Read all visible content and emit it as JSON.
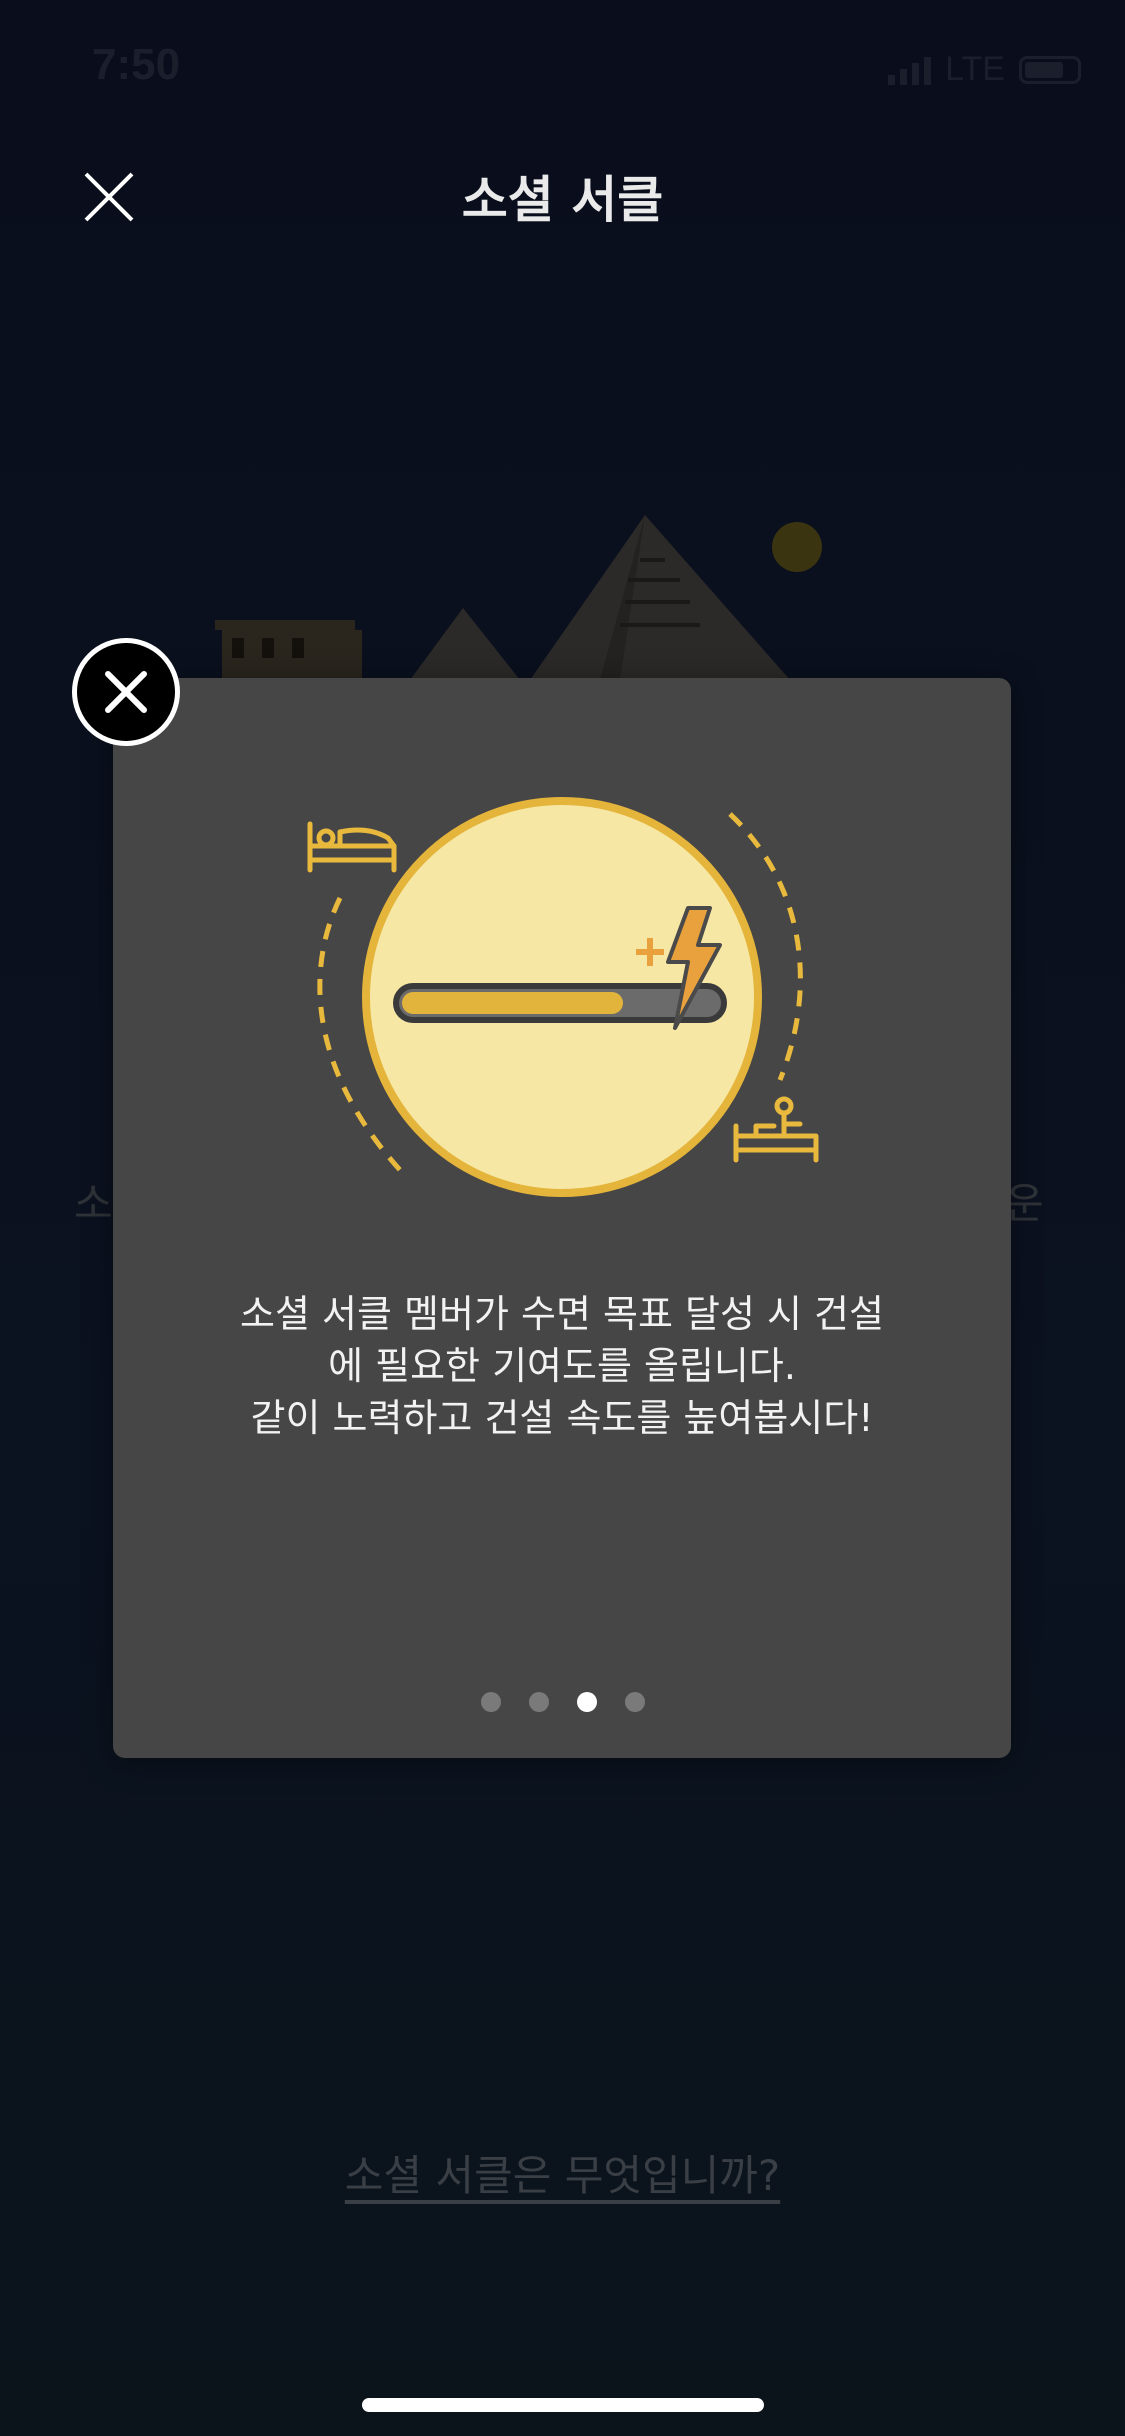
{
  "status_bar": {
    "time": "7:50",
    "network": "LTE",
    "battery_level": 0.75
  },
  "header": {
    "title": "소셜 서클",
    "close_icon": "close-icon"
  },
  "background": {
    "left_text": "소",
    "right_text": "운",
    "link_text": "소셜 서클은 무엇입니까?"
  },
  "modal": {
    "close_icon": "close-circle-icon",
    "illustration": {
      "progress_fill": 0.7,
      "icons": [
        "bed-sleeping-icon",
        "bed-waking-icon",
        "lightning-icon",
        "plus-icon"
      ],
      "accent_color": "#e8b93c",
      "circle_color": "#f6e7a5",
      "bolt_color": "#e8a13c"
    },
    "text_lines": [
      "소셜 서클 멤버가 수면 목표 달성 시 건설",
      "에 필요한 기여도를 올립니다.",
      "같이 노력하고 건설 속도를 높여봅시다!"
    ],
    "pagination": {
      "total": 4,
      "current": 3
    }
  }
}
